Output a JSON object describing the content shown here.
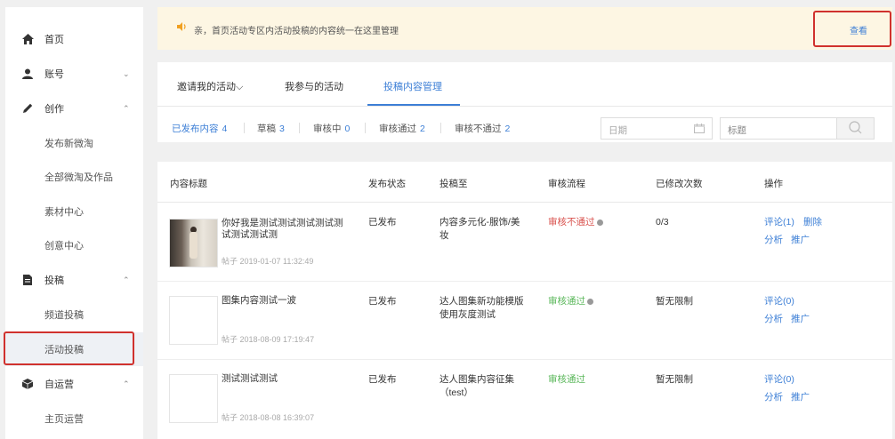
{
  "sidebar": {
    "home": "首页",
    "account": "账号",
    "create": "创作",
    "publish_weitao": "发布新微淘",
    "all_weitao": "全部微淘及作品",
    "materials": "素材中心",
    "creative": "创意中心",
    "submit": "投稿",
    "channel_submit": "频道投稿",
    "activity_submit": "活动投稿",
    "self_operate": "自运营",
    "homepage_operate": "主页运营"
  },
  "notice": {
    "text": "亲，首页活动专区内活动投稿的内容统一在这里管理",
    "view": "查看"
  },
  "tabs": [
    {
      "label": "邀请我的活动"
    },
    {
      "label": "我参与的活动"
    },
    {
      "label": "投稿内容管理"
    }
  ],
  "filters": [
    {
      "label": "已发布内容",
      "count": "4"
    },
    {
      "label": "草稿",
      "count": "3"
    },
    {
      "label": "审核中",
      "count": "0"
    },
    {
      "label": "审核通过",
      "count": "2"
    },
    {
      "label": "审核不通过",
      "count": "2"
    }
  ],
  "search": {
    "date_placeholder": "日期",
    "title_placeholder": "标题"
  },
  "table": {
    "headers": [
      "内容标题",
      "发布状态",
      "投稿至",
      "审核流程",
      "已修改次数",
      "操作"
    ],
    "rows": [
      {
        "title": "你好我是测试测试测试测试测试测试测试测",
        "meta": "帖子 2019-01-07 11:32:49",
        "status": "已发布",
        "target": "内容多元化-服饰/美妆",
        "review": "审核不通过",
        "edits": "0/3",
        "actions": [
          "评论(1)",
          "删除",
          "分析",
          "推广"
        ]
      },
      {
        "title": "图集内容测试一波",
        "meta": "帖子 2018-08-09 17:19:47",
        "status": "已发布",
        "target": "达人图集新功能模版使用灰度测试",
        "review": "审核通过",
        "edits": "暂无限制",
        "actions": [
          "评论(0)",
          "分析",
          "推广"
        ]
      },
      {
        "title": "测试测试测试",
        "meta": "帖子 2018-08-08 16:39:07",
        "status": "已发布",
        "target": "达人图集内容征集（test）",
        "review": "审核通过",
        "edits": "暂无限制",
        "actions": [
          "评论(0)",
          "分析",
          "推广"
        ]
      }
    ]
  },
  "colors": {
    "accent": "#3d7fd6",
    "highlight": "#d0312d",
    "notice_bg": "#fdf6e3",
    "fail": "#d9534f",
    "pass": "#5cb85c"
  }
}
